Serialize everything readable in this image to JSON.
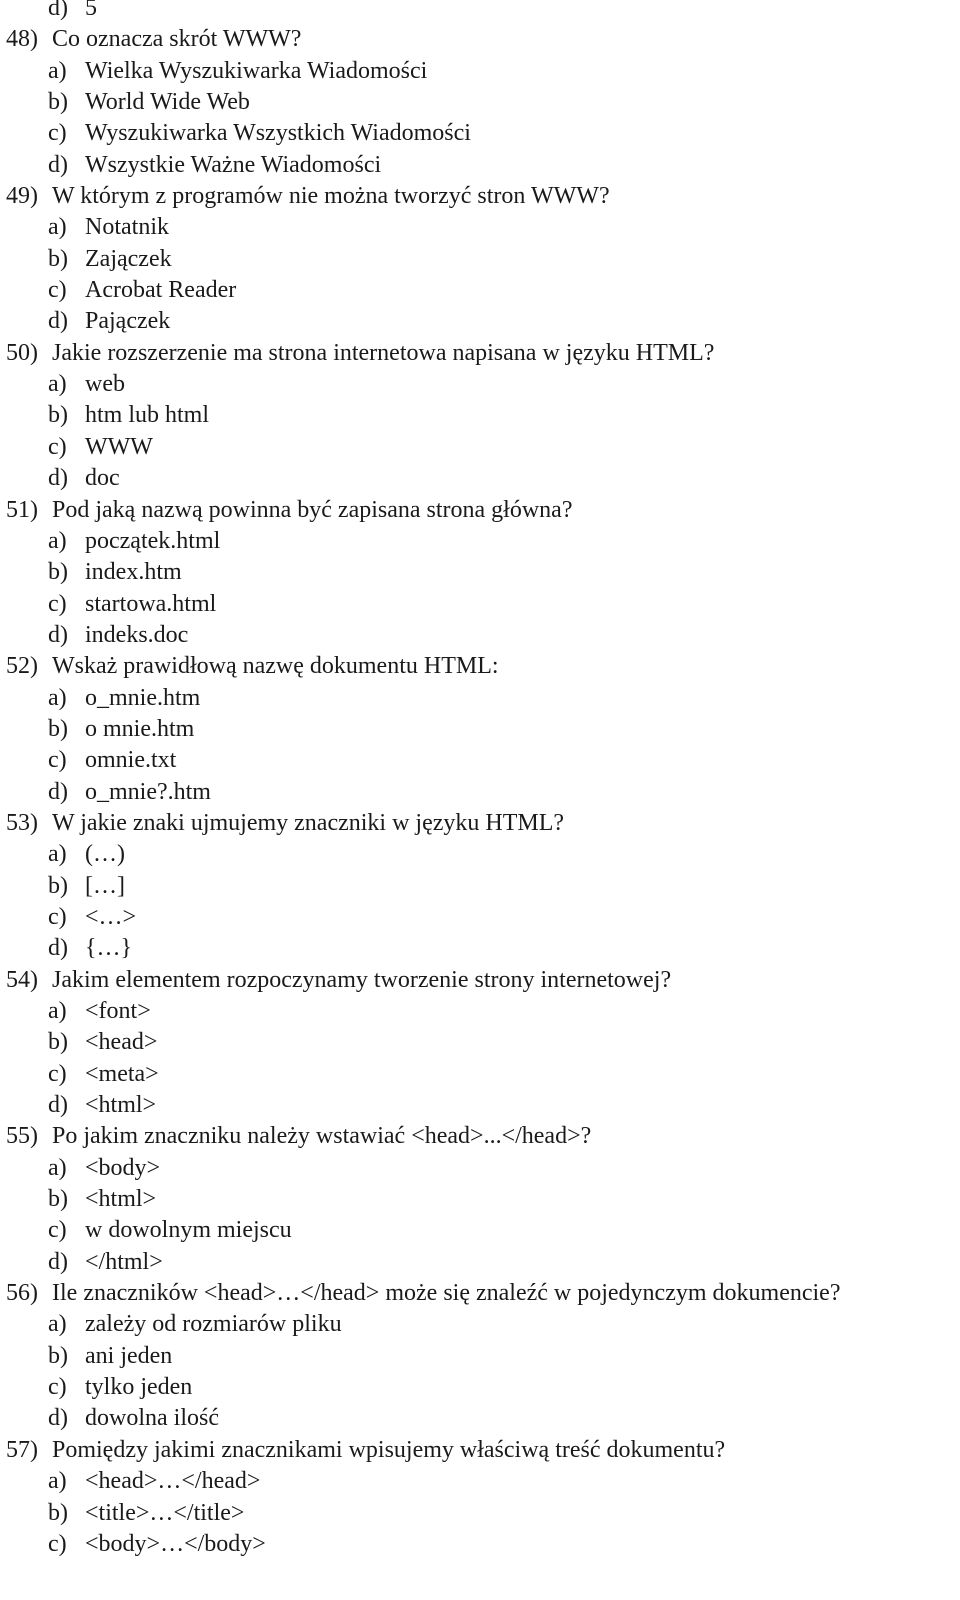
{
  "document": {
    "leading_options": [
      {
        "letter": "d)",
        "text": "5"
      }
    ],
    "questions": [
      {
        "number": "48)",
        "text": "Co oznacza skrót WWW?",
        "options": [
          {
            "letter": "a)",
            "text": "Wielka Wyszukiwarka Wiadomości"
          },
          {
            "letter": "b)",
            "text": "World Wide Web"
          },
          {
            "letter": "c)",
            "text": "Wyszukiwarka Wszystkich Wiadomości"
          },
          {
            "letter": "d)",
            "text": "Wszystkie Ważne Wiadomości"
          }
        ]
      },
      {
        "number": "49)",
        "text": "W którym z programów nie można tworzyć stron WWW?",
        "options": [
          {
            "letter": "a)",
            "text": "Notatnik"
          },
          {
            "letter": "b)",
            "text": "Zajączek"
          },
          {
            "letter": "c)",
            "text": "Acrobat Reader"
          },
          {
            "letter": "d)",
            "text": "Pajączek"
          }
        ]
      },
      {
        "number": "50)",
        "text": "Jakie rozszerzenie ma strona internetowa napisana w języku HTML?",
        "options": [
          {
            "letter": "a)",
            "text": "web"
          },
          {
            "letter": "b)",
            "text": "htm lub html"
          },
          {
            "letter": "c)",
            "text": "WWW"
          },
          {
            "letter": "d)",
            "text": "doc"
          }
        ]
      },
      {
        "number": "51)",
        "text": "Pod jaką nazwą powinna być zapisana strona główna?",
        "options": [
          {
            "letter": "a)",
            "text": "początek.html"
          },
          {
            "letter": "b)",
            "text": "index.htm"
          },
          {
            "letter": "c)",
            "text": "startowa.html"
          },
          {
            "letter": "d)",
            "text": "indeks.doc"
          }
        ]
      },
      {
        "number": "52)",
        "text": "Wskaż prawidłową nazwę dokumentu HTML:",
        "options": [
          {
            "letter": "a)",
            "text": "o_mnie.htm"
          },
          {
            "letter": "b)",
            "text": "o mnie.htm"
          },
          {
            "letter": "c)",
            "text": "omnie.txt"
          },
          {
            "letter": "d)",
            "text": "o_mnie?.htm"
          }
        ]
      },
      {
        "number": "53)",
        "text": "W jakie znaki ujmujemy znaczniki w języku HTML?",
        "options": [
          {
            "letter": "a)",
            "text": "(…)"
          },
          {
            "letter": "b)",
            "text": "[…]"
          },
          {
            "letter": "c)",
            "text": "<…>"
          },
          {
            "letter": "d)",
            "text": "{…}"
          }
        ]
      },
      {
        "number": "54)",
        "text": "Jakim elementem rozpoczynamy tworzenie strony internetowej?",
        "options": [
          {
            "letter": "a)",
            "text": "<font>"
          },
          {
            "letter": "b)",
            "text": "<head>"
          },
          {
            "letter": "c)",
            "text": "<meta>"
          },
          {
            "letter": "d)",
            "text": "<html>"
          }
        ]
      },
      {
        "number": "55)",
        "text": "Po jakim znaczniku należy wstawiać <head>...</head>?",
        "options": [
          {
            "letter": "a)",
            "text": "<body>"
          },
          {
            "letter": "b)",
            "text": "<html>"
          },
          {
            "letter": "c)",
            "text": "w dowolnym miejscu"
          },
          {
            "letter": "d)",
            "text": "</html>"
          }
        ]
      },
      {
        "number": "56)",
        "text": "Ile znaczników <head>…</head> może się znaleźć w pojedynczym dokumencie?",
        "options": [
          {
            "letter": "a)",
            "text": "zależy od rozmiarów pliku"
          },
          {
            "letter": "b)",
            "text": "ani jeden"
          },
          {
            "letter": "c)",
            "text": "tylko jeden"
          },
          {
            "letter": "d)",
            "text": "dowolna ilość"
          }
        ]
      },
      {
        "number": "57)",
        "text": "Pomiędzy jakimi znacznikami wpisujemy właściwą treść dokumentu?",
        "options": [
          {
            "letter": "a)",
            "text": "<head>…</head>"
          },
          {
            "letter": "b)",
            "text": "<title>…</title>"
          },
          {
            "letter": "c)",
            "text": "<body>…</body>"
          }
        ]
      }
    ]
  }
}
